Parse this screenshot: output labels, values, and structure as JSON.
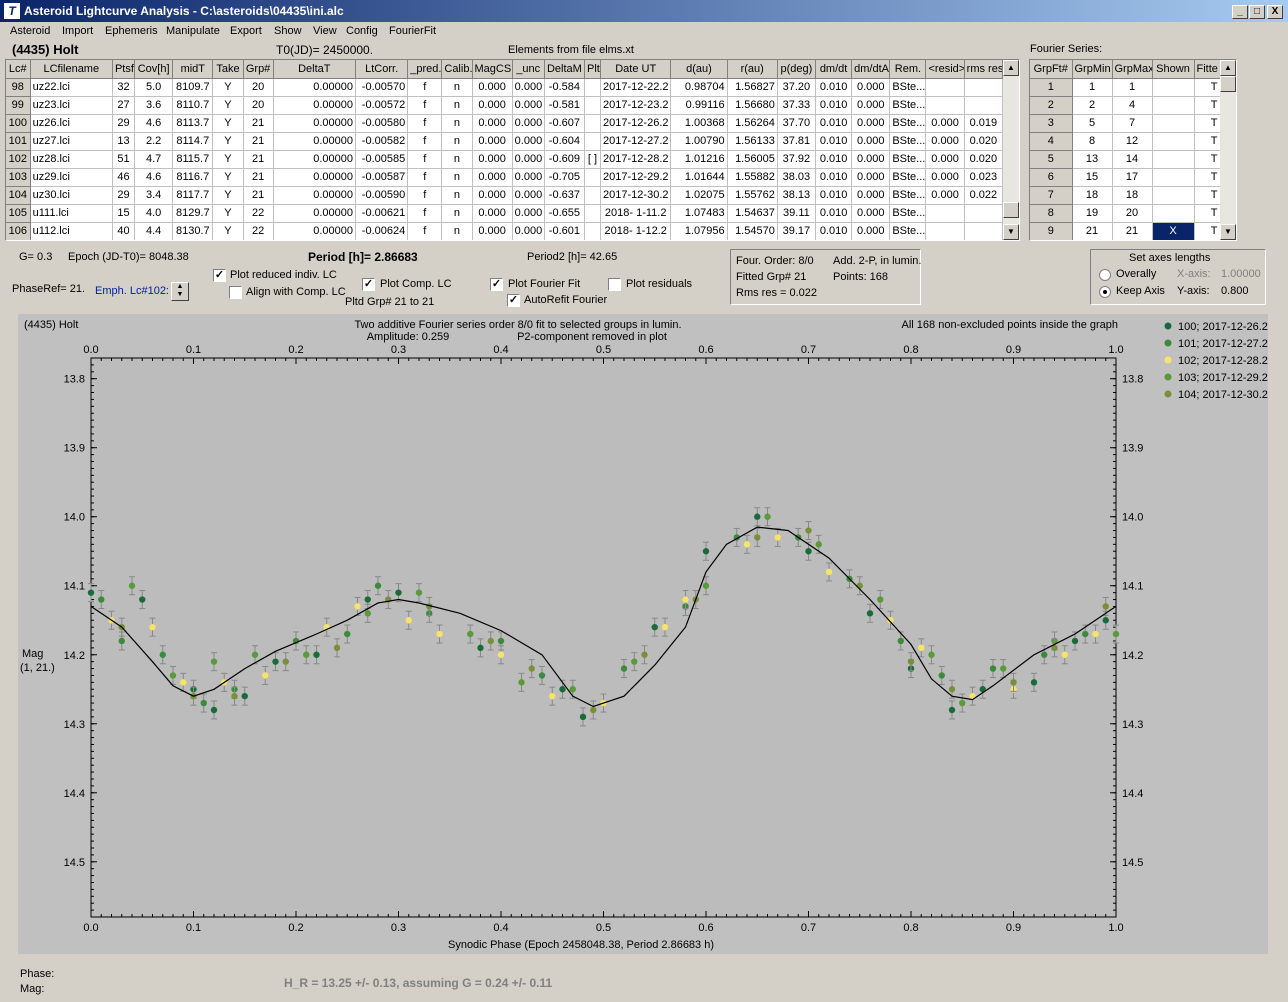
{
  "window": {
    "title": "Asteroid Lightcurve Analysis - C:\\asteroids\\04435\\ini.alc",
    "minimize": "_",
    "maximize": "□",
    "close": "X"
  },
  "menu": [
    "Asteroid",
    "Import",
    "Ephemeris",
    "Manipulate",
    "Export",
    "Show",
    "View",
    "Config",
    "FourierFit"
  ],
  "header": {
    "asteroid": "(4435) Holt",
    "t0": "T0(JD)= 2450000.",
    "elements": "Elements from file elms.xt",
    "fourier_series": "Fourier Series:"
  },
  "lc_table": {
    "columns": [
      "Lc#",
      "LCfilename",
      "Ptsf",
      "Cov[h]",
      "midT",
      "Take",
      "Grp#",
      "DeltaT",
      "LtCorr.",
      "_pred.",
      "Calib.",
      "MagCS",
      "_unc",
      "DeltaM",
      "Plt",
      "Date UT",
      "d(au)",
      "r(au)",
      "p(deg)",
      "dm/dt",
      "dm/dtA",
      "Rem.",
      "<resid>",
      "rms res"
    ],
    "rows": [
      [
        "98",
        "uz22.lci",
        "32",
        "5.0",
        "8109.7",
        "Y",
        "20",
        "0.00000",
        "-0.00570",
        "f",
        "n",
        "0.000",
        "0.000",
        "-0.584",
        "",
        "2017-12-22.2",
        "0.98704",
        "1.56827",
        "37.20",
        "0.010",
        "0.000",
        "BSte...",
        "",
        ""
      ],
      [
        "99",
        "uz23.lci",
        "27",
        "3.6",
        "8110.7",
        "Y",
        "20",
        "0.00000",
        "-0.00572",
        "f",
        "n",
        "0.000",
        "0.000",
        "-0.581",
        "",
        "2017-12-23.2",
        "0.99116",
        "1.56680",
        "37.33",
        "0.010",
        "0.000",
        "BSte...",
        "",
        ""
      ],
      [
        "100",
        "uz26.lci",
        "29",
        "4.6",
        "8113.7",
        "Y",
        "21",
        "0.00000",
        "-0.00580",
        "f",
        "n",
        "0.000",
        "0.000",
        "-0.607",
        "",
        "2017-12-26.2",
        "1.00368",
        "1.56264",
        "37.70",
        "0.010",
        "0.000",
        "BSte...",
        "0.000",
        "0.019"
      ],
      [
        "101",
        "uz27.lci",
        "13",
        "2.2",
        "8114.7",
        "Y",
        "21",
        "0.00000",
        "-0.00582",
        "f",
        "n",
        "0.000",
        "0.000",
        "-0.604",
        "",
        "2017-12-27.2",
        "1.00790",
        "1.56133",
        "37.81",
        "0.010",
        "0.000",
        "BSte...",
        "0.000",
        "0.020"
      ],
      [
        "102",
        "uz28.lci",
        "51",
        "4.7",
        "8115.7",
        "Y",
        "21",
        "0.00000",
        "-0.00585",
        "f",
        "n",
        "0.000",
        "0.000",
        "-0.609",
        "[ ]",
        "2017-12-28.2",
        "1.01216",
        "1.56005",
        "37.92",
        "0.010",
        "0.000",
        "BSte...",
        "0.000",
        "0.020"
      ],
      [
        "103",
        "uz29.lci",
        "46",
        "4.6",
        "8116.7",
        "Y",
        "21",
        "0.00000",
        "-0.00587",
        "f",
        "n",
        "0.000",
        "0.000",
        "-0.705",
        "",
        "2017-12-29.2",
        "1.01644",
        "1.55882",
        "38.03",
        "0.010",
        "0.000",
        "BSte...",
        "0.000",
        "0.023"
      ],
      [
        "104",
        "uz30.lci",
        "29",
        "3.4",
        "8117.7",
        "Y",
        "21",
        "0.00000",
        "-0.00590",
        "f",
        "n",
        "0.000",
        "0.000",
        "-0.637",
        "",
        "2017-12-30.2",
        "1.02075",
        "1.55762",
        "38.13",
        "0.010",
        "0.000",
        "BSte...",
        "0.000",
        "0.022"
      ],
      [
        "105",
        "u111.lci",
        "15",
        "4.0",
        "8129.7",
        "Y",
        "22",
        "0.00000",
        "-0.00621",
        "f",
        "n",
        "0.000",
        "0.000",
        "-0.655",
        "",
        "2018- 1-11.2",
        "1.07483",
        "1.54637",
        "39.11",
        "0.010",
        "0.000",
        "BSte...",
        "",
        ""
      ],
      [
        "106",
        "u112.lci",
        "40",
        "4.4",
        "8130.7",
        "Y",
        "22",
        "0.00000",
        "-0.00624",
        "f",
        "n",
        "0.000",
        "0.000",
        "-0.601",
        "",
        "2018- 1-12.2",
        "1.07956",
        "1.54570",
        "39.17",
        "0.010",
        "0.000",
        "BSte...",
        "",
        ""
      ]
    ]
  },
  "fourier_table": {
    "columns": [
      "GrpFt#",
      "GrpMin",
      "GrpMax",
      "Shown",
      "Fitte"
    ],
    "rows": [
      [
        "1",
        "1",
        "1",
        "",
        "T"
      ],
      [
        "2",
        "2",
        "4",
        "",
        "T"
      ],
      [
        "3",
        "5",
        "7",
        "",
        "T"
      ],
      [
        "4",
        "8",
        "12",
        "",
        "T"
      ],
      [
        "5",
        "13",
        "14",
        "",
        "T"
      ],
      [
        "6",
        "15",
        "17",
        "",
        "T"
      ],
      [
        "7",
        "18",
        "18",
        "",
        "T"
      ],
      [
        "8",
        "19",
        "20",
        "",
        "T"
      ],
      [
        "9",
        "21",
        "21",
        "X",
        "T"
      ]
    ]
  },
  "controls": {
    "g": "G= 0.3",
    "epoch": "Epoch (JD-T0)= 8048.38",
    "period": "Period [h]= 2.86683",
    "period2": "Period2 [h]= 42.65",
    "phaseref": "PhaseRef= 21.",
    "emph": "Emph. Lc#102:",
    "plot_reduced": "Plot reduced indiv. LC",
    "align": "Align with Comp. LC",
    "plot_comp": "Plot Comp. LC",
    "pltd_grp": "Pltd Grp#  21 to   21",
    "plot_fourier": "Plot Fourier Fit",
    "autorefit": "AutoRefit Fourier",
    "plot_resid": "Plot residuals",
    "four_order": "Four. Order:  8/0",
    "add2p": "Add. 2-P, in lumin.",
    "fitted_grp": "Fitted Grp# 21",
    "points": "Points: 168",
    "rms": "Rms res     = 0.022",
    "axes_title": "Set axes lengths",
    "overally": "Overally",
    "keep_axis": "Keep Axis",
    "xaxis_label": "X-axis:",
    "xaxis_val": "1.00000",
    "yaxis_label": "Y-axis:",
    "yaxis_val": "0.800"
  },
  "bottom": {
    "phase": "Phase:",
    "mag": "Mag:",
    "hr": "H_R = 13.25 +/- 0.13, assuming G = 0.24 +/- 0.11"
  },
  "chart_data": {
    "type": "scatter",
    "title_left": "(4435) Holt",
    "title_center": "Two additive Fourier series order 8/0 fit to selected groups in lumin.",
    "amplitude": "Amplitude: 0.259",
    "p2": "P2-component removed in plot",
    "title_right": "All 168 non-excluded points inside the graph",
    "xlabel": "Synodic Phase (Epoch 2458048.38, Period 2.86683 h)",
    "ylabel": "Mag",
    "ylabel2": "(1, 21.)",
    "xlim": [
      0,
      1
    ],
    "ylim": [
      13.77,
      14.58
    ],
    "xticks": [
      "0.0",
      "0.1",
      "0.2",
      "0.3",
      "0.4",
      "0.5",
      "0.6",
      "0.7",
      "0.8",
      "0.9",
      "1.0"
    ],
    "yticks": [
      "13.8",
      "13.9",
      "14.0",
      "14.1",
      "14.2",
      "14.3",
      "14.4",
      "14.5"
    ],
    "curve": [
      [
        0.0,
        14.13
      ],
      [
        0.03,
        14.16
      ],
      [
        0.06,
        14.21
      ],
      [
        0.08,
        14.245
      ],
      [
        0.1,
        14.26
      ],
      [
        0.12,
        14.25
      ],
      [
        0.15,
        14.22
      ],
      [
        0.18,
        14.195
      ],
      [
        0.22,
        14.17
      ],
      [
        0.25,
        14.15
      ],
      [
        0.28,
        14.125
      ],
      [
        0.3,
        14.12
      ],
      [
        0.32,
        14.125
      ],
      [
        0.36,
        14.14
      ],
      [
        0.4,
        14.165
      ],
      [
        0.44,
        14.2
      ],
      [
        0.47,
        14.26
      ],
      [
        0.49,
        14.275
      ],
      [
        0.52,
        14.26
      ],
      [
        0.55,
        14.215
      ],
      [
        0.58,
        14.16
      ],
      [
        0.6,
        14.08
      ],
      [
        0.62,
        14.04
      ],
      [
        0.65,
        14.015
      ],
      [
        0.68,
        14.02
      ],
      [
        0.72,
        14.06
      ],
      [
        0.76,
        14.12
      ],
      [
        0.8,
        14.185
      ],
      [
        0.82,
        14.235
      ],
      [
        0.84,
        14.26
      ],
      [
        0.86,
        14.265
      ],
      [
        0.88,
        14.245
      ],
      [
        0.92,
        14.2
      ],
      [
        0.96,
        14.17
      ],
      [
        1.0,
        14.13
      ]
    ],
    "series": [
      {
        "name": "100; 2017-12-26.2",
        "color": "#1a6b3a",
        "points": [
          [
            0.0,
            14.11
          ],
          [
            0.05,
            14.12
          ],
          [
            0.1,
            14.25
          ],
          [
            0.12,
            14.28
          ],
          [
            0.15,
            14.26
          ],
          [
            0.18,
            14.21
          ],
          [
            0.22,
            14.2
          ],
          [
            0.27,
            14.12
          ],
          [
            0.3,
            14.11
          ],
          [
            0.38,
            14.19
          ],
          [
            0.46,
            14.25
          ],
          [
            0.48,
            14.29
          ],
          [
            0.55,
            14.16
          ],
          [
            0.6,
            14.05
          ],
          [
            0.65,
            14.0
          ],
          [
            0.7,
            14.05
          ],
          [
            0.76,
            14.14
          ],
          [
            0.8,
            14.22
          ],
          [
            0.84,
            14.28
          ],
          [
            0.87,
            14.25
          ],
          [
            0.92,
            14.24
          ],
          [
            0.96,
            14.18
          ],
          [
            0.99,
            14.15
          ]
        ]
      },
      {
        "name": "101; 2017-12-27.2",
        "color": "#3c8a3c",
        "points": [
          [
            0.01,
            14.12
          ],
          [
            0.03,
            14.18
          ],
          [
            0.07,
            14.2
          ],
          [
            0.11,
            14.27
          ],
          [
            0.14,
            14.25
          ],
          [
            0.2,
            14.18
          ],
          [
            0.25,
            14.17
          ],
          [
            0.28,
            14.1
          ],
          [
            0.33,
            14.14
          ],
          [
            0.4,
            14.18
          ],
          [
            0.44,
            14.23
          ],
          [
            0.52,
            14.22
          ],
          [
            0.58,
            14.13
          ],
          [
            0.63,
            14.03
          ],
          [
            0.69,
            14.03
          ],
          [
            0.74,
            14.09
          ],
          [
            0.79,
            14.18
          ],
          [
            0.83,
            14.23
          ],
          [
            0.88,
            14.22
          ],
          [
            0.93,
            14.2
          ],
          [
            0.97,
            14.17
          ]
        ]
      },
      {
        "name": "102; 2017-12-28.2",
        "color": "#f5e36a",
        "points": [
          [
            0.02,
            14.15
          ],
          [
            0.06,
            14.16
          ],
          [
            0.09,
            14.24
          ],
          [
            0.13,
            14.24
          ],
          [
            0.17,
            14.23
          ],
          [
            0.23,
            14.16
          ],
          [
            0.26,
            14.13
          ],
          [
            0.31,
            14.15
          ],
          [
            0.34,
            14.17
          ],
          [
            0.4,
            14.2
          ],
          [
            0.45,
            14.26
          ],
          [
            0.5,
            14.27
          ],
          [
            0.56,
            14.16
          ],
          [
            0.58,
            14.12
          ],
          [
            0.64,
            14.04
          ],
          [
            0.67,
            14.03
          ],
          [
            0.72,
            14.08
          ],
          [
            0.78,
            14.15
          ],
          [
            0.81,
            14.19
          ],
          [
            0.86,
            14.26
          ],
          [
            0.9,
            14.25
          ],
          [
            0.95,
            14.2
          ],
          [
            0.98,
            14.17
          ]
        ]
      },
      {
        "name": "103; 2017-12-29.2",
        "color": "#5a9a3a",
        "points": [
          [
            0.04,
            14.1
          ],
          [
            0.08,
            14.23
          ],
          [
            0.12,
            14.21
          ],
          [
            0.16,
            14.2
          ],
          [
            0.21,
            14.2
          ],
          [
            0.27,
            14.14
          ],
          [
            0.32,
            14.11
          ],
          [
            0.37,
            14.17
          ],
          [
            0.42,
            14.24
          ],
          [
            0.47,
            14.25
          ],
          [
            0.53,
            14.21
          ],
          [
            0.6,
            14.1
          ],
          [
            0.66,
            14.0
          ],
          [
            0.71,
            14.04
          ],
          [
            0.77,
            14.12
          ],
          [
            0.82,
            14.2
          ],
          [
            0.85,
            14.27
          ],
          [
            0.89,
            14.22
          ],
          [
            0.94,
            14.18
          ],
          [
            1.0,
            14.17
          ]
        ]
      },
      {
        "name": "104; 2017-12-30.2",
        "color": "#7a8f3a",
        "points": [
          [
            0.03,
            14.16
          ],
          [
            0.1,
            14.26
          ],
          [
            0.14,
            14.26
          ],
          [
            0.19,
            14.21
          ],
          [
            0.24,
            14.19
          ],
          [
            0.29,
            14.12
          ],
          [
            0.33,
            14.13
          ],
          [
            0.39,
            14.18
          ],
          [
            0.43,
            14.22
          ],
          [
            0.49,
            14.28
          ],
          [
            0.54,
            14.2
          ],
          [
            0.59,
            14.12
          ],
          [
            0.65,
            14.03
          ],
          [
            0.7,
            14.02
          ],
          [
            0.75,
            14.1
          ],
          [
            0.8,
            14.21
          ],
          [
            0.84,
            14.25
          ],
          [
            0.9,
            14.24
          ],
          [
            0.94,
            14.19
          ],
          [
            0.99,
            14.13
          ]
        ]
      }
    ]
  }
}
